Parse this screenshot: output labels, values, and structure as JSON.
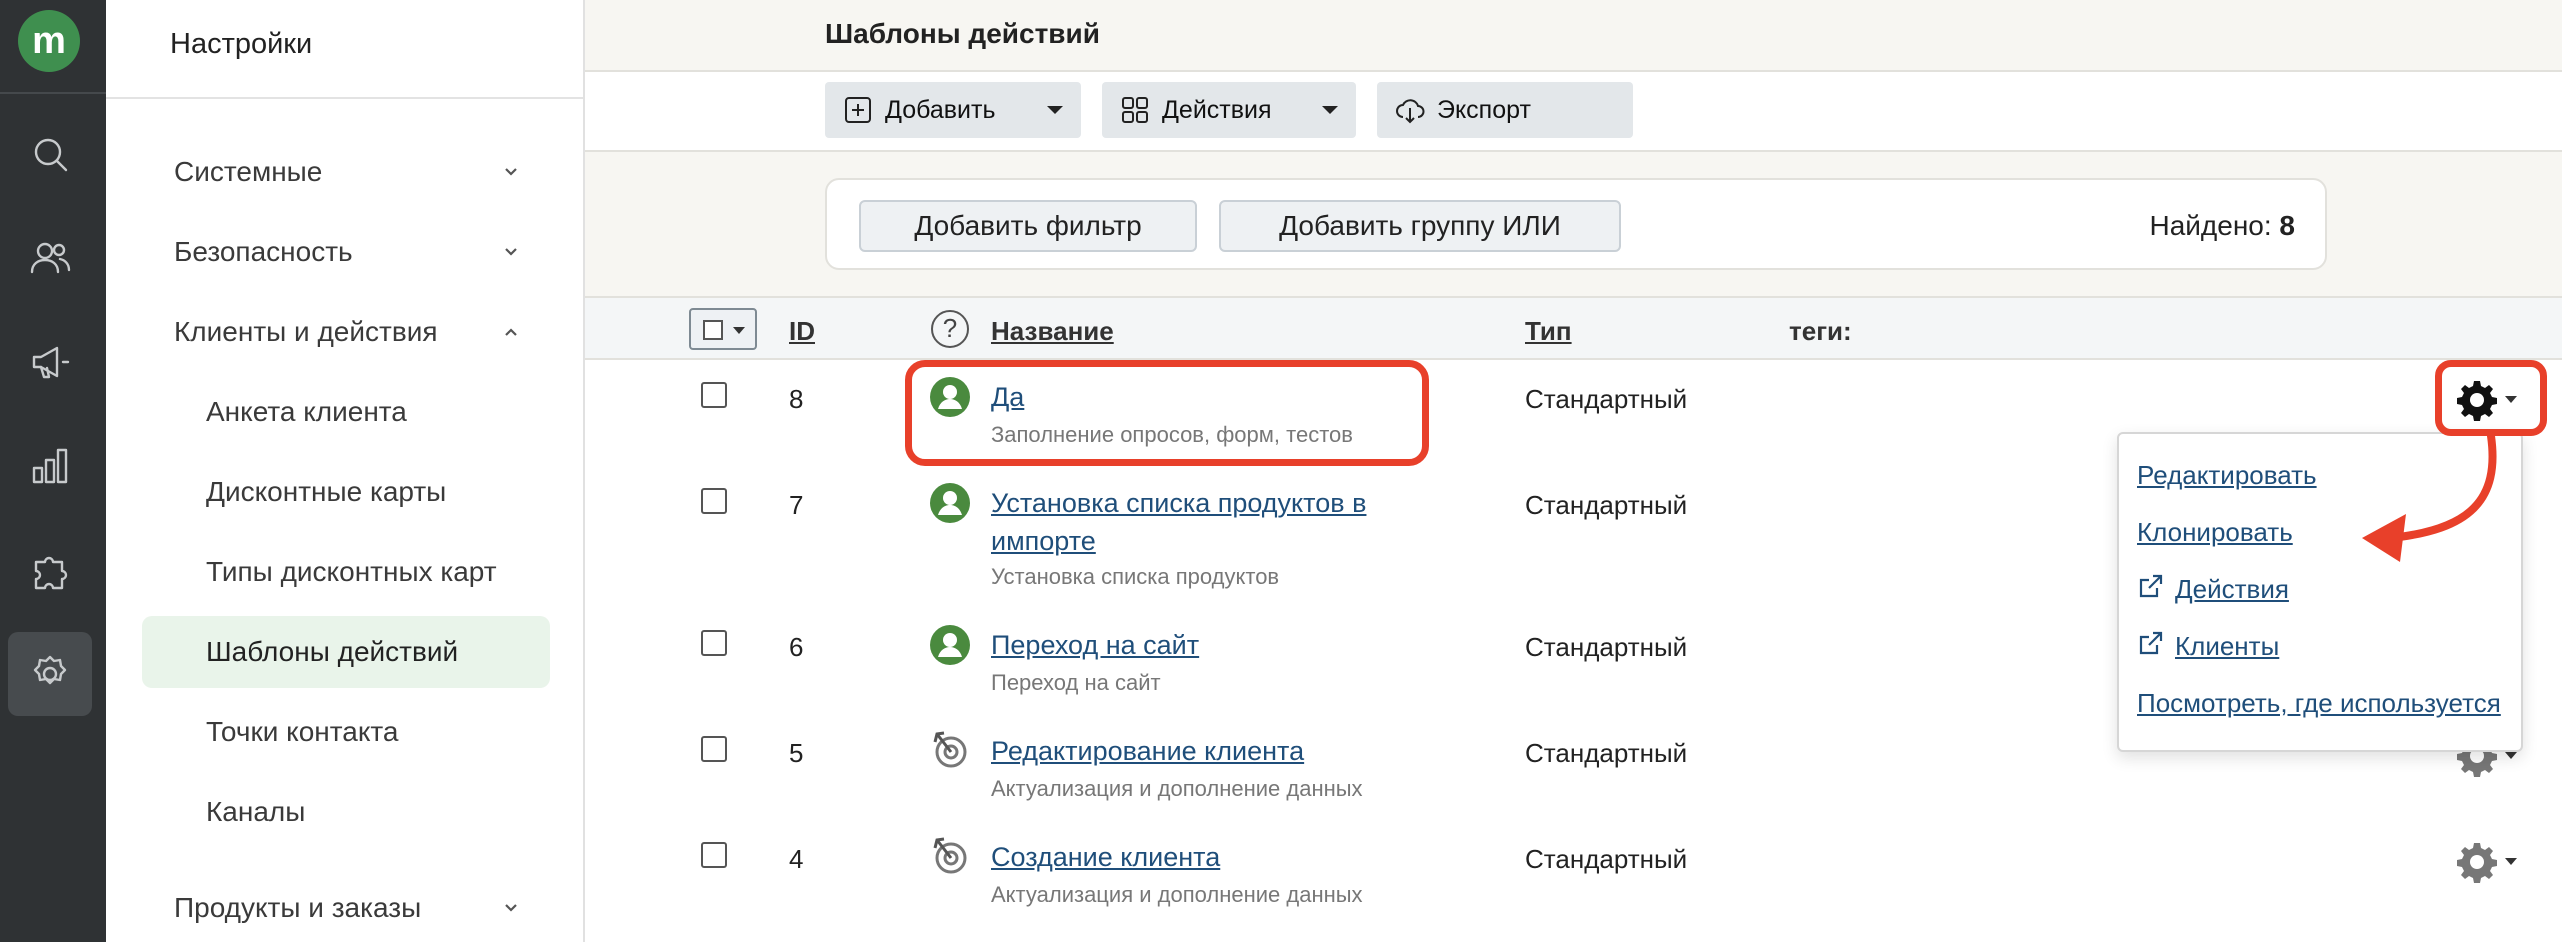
{
  "app": {
    "logo_letter": "m",
    "brand_color": "#3f8f4f",
    "accent_red": "#e8402a"
  },
  "rail": {
    "icons": [
      "search-icon",
      "users-icon",
      "megaphone-icon",
      "chart-icon",
      "puzzle-icon",
      "gear-icon"
    ],
    "active": "gear-icon"
  },
  "sidebar": {
    "title": "Настройки",
    "sections": [
      {
        "label": "Системные",
        "expanded": false
      },
      {
        "label": "Безопасность",
        "expanded": false
      },
      {
        "label": "Клиенты и действия",
        "expanded": true
      },
      {
        "label": "Продукты и заказы",
        "expanded": false
      }
    ],
    "items": [
      {
        "label": "Анкета клиента"
      },
      {
        "label": "Дисконтные карты"
      },
      {
        "label": "Типы дисконтных карт"
      },
      {
        "label": "Шаблоны действий",
        "active": true
      },
      {
        "label": "Точки контакта"
      },
      {
        "label": "Каналы"
      }
    ]
  },
  "header": {
    "title": "Шаблоны действий"
  },
  "toolbar": {
    "add_label": "Добавить",
    "actions_label": "Действия",
    "export_label": "Экспорт"
  },
  "filters": {
    "add_filter": "Добавить фильтр",
    "add_or_group": "Добавить группу ИЛИ",
    "found_label": "Найдено:",
    "found_count": "8"
  },
  "table": {
    "columns": {
      "id": "ID",
      "name": "Название",
      "type": "Тип",
      "tags": "теги:"
    },
    "rows": [
      {
        "id": "8",
        "name": "Да",
        "subtitle": "Заполнение опросов, форм, тестов",
        "type": "Стандартный",
        "icon": "user-circle-icon"
      },
      {
        "id": "7",
        "name": "Установка списка продуктов в импорте",
        "subtitle": "Установка списка продуктов",
        "type": "Стандартный",
        "icon": "user-circle-icon"
      },
      {
        "id": "6",
        "name": "Переход на сайт",
        "subtitle": "Переход на сайт",
        "type": "Стандартный",
        "icon": "user-circle-icon"
      },
      {
        "id": "5",
        "name": "Редактирование клиента",
        "subtitle": "Актуализация и дополнение данных",
        "type": "Стандартный",
        "icon": "target-arrow-icon"
      },
      {
        "id": "4",
        "name": "Создание клиента",
        "subtitle": "Актуализация и дополнение данных",
        "type": "Стандартный",
        "icon": "target-arrow-icon"
      }
    ]
  },
  "context_menu": {
    "items": [
      {
        "label": "Редактировать",
        "external": false
      },
      {
        "label": "Клонировать",
        "external": false
      },
      {
        "label": "Действия",
        "external": true
      },
      {
        "label": "Клиенты",
        "external": true
      },
      {
        "label": "Посмотреть, где используется",
        "external": false
      }
    ]
  }
}
